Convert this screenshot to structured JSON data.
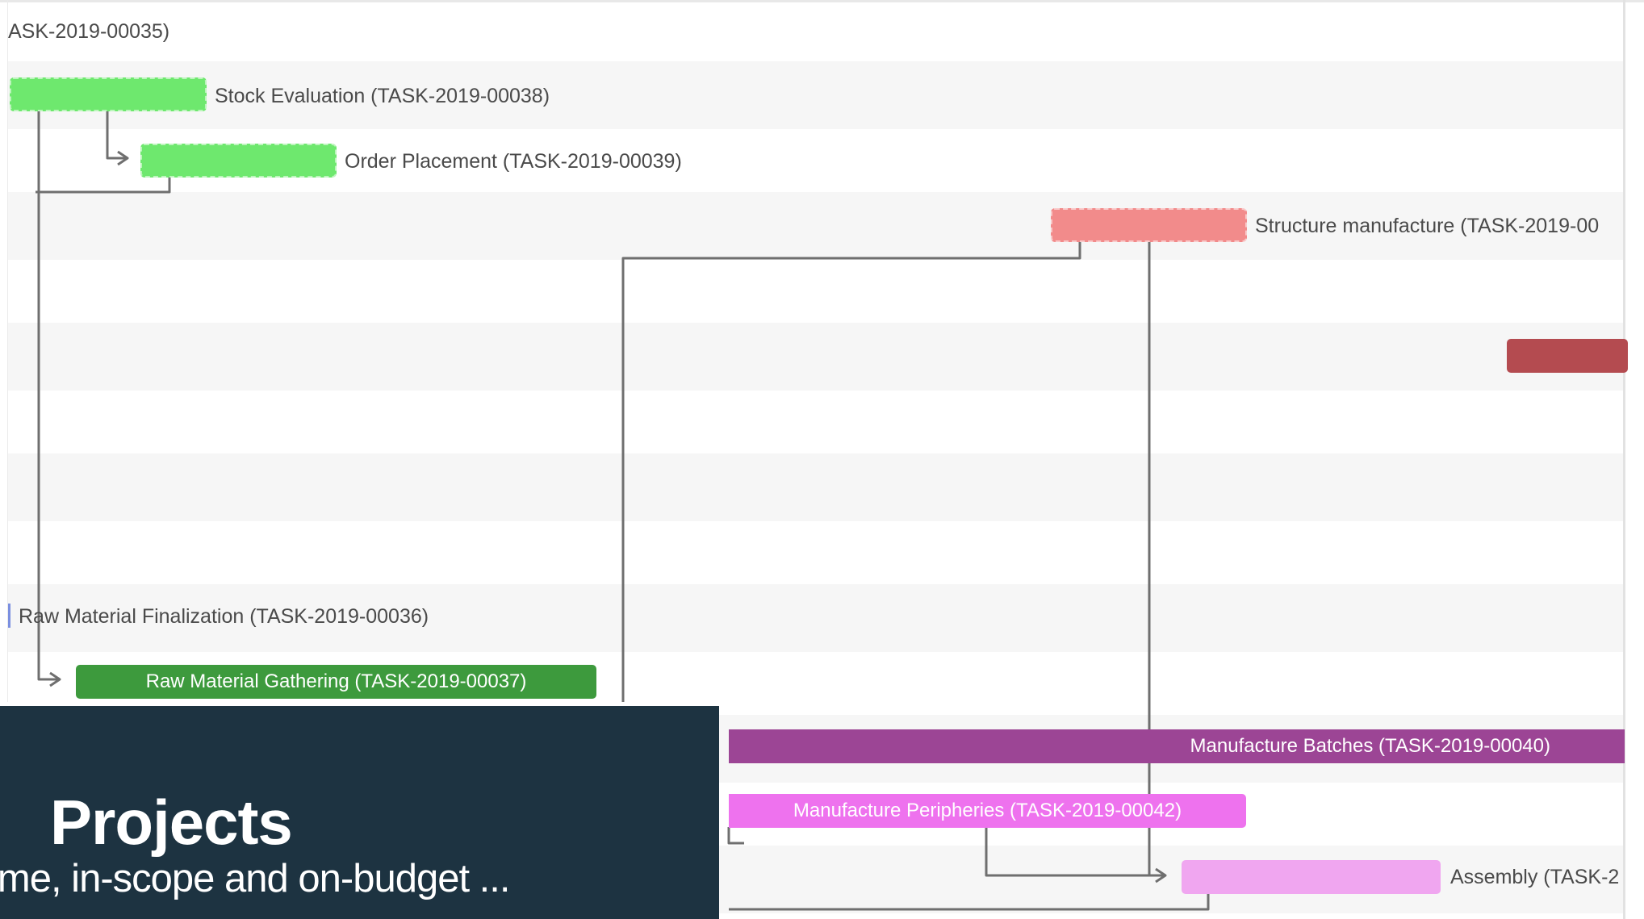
{
  "colors": {
    "done": "#6ee86e",
    "overdue_planned": "#f28b8b",
    "overdue_dark": "#b44b50",
    "in_progress": "#3d9a3d",
    "purple": "#9c4595",
    "pink": "#ee72ee",
    "light_pink": "#f0a6f0",
    "connector": "#6f6f6f",
    "overlay_bg": "#1d3341"
  },
  "tasks": {
    "task_35": {
      "label": "ASK-2019-00035)"
    },
    "task_38": {
      "label": "Stock Evaluation (TASK-2019-00038)"
    },
    "task_39": {
      "label": "Order Placement (TASK-2019-00039)"
    },
    "task_structure": {
      "label": "Structure manufacture (TASK-2019-00"
    },
    "task_36": {
      "label": "Raw Material Finalization (TASK-2019-00036)"
    },
    "task_37": {
      "label": "Raw Material Gathering (TASK-2019-00037)"
    },
    "task_40": {
      "label": "Manufacture Batches (TASK-2019-00040)"
    },
    "task_42": {
      "label": "Manufacture Peripheries (TASK-2019-00042)"
    },
    "task_assembly": {
      "label": "Assembly (TASK-2"
    }
  },
  "overlay": {
    "title": "Projects",
    "subtitle": "ime, in-scope and on-budget ..."
  }
}
